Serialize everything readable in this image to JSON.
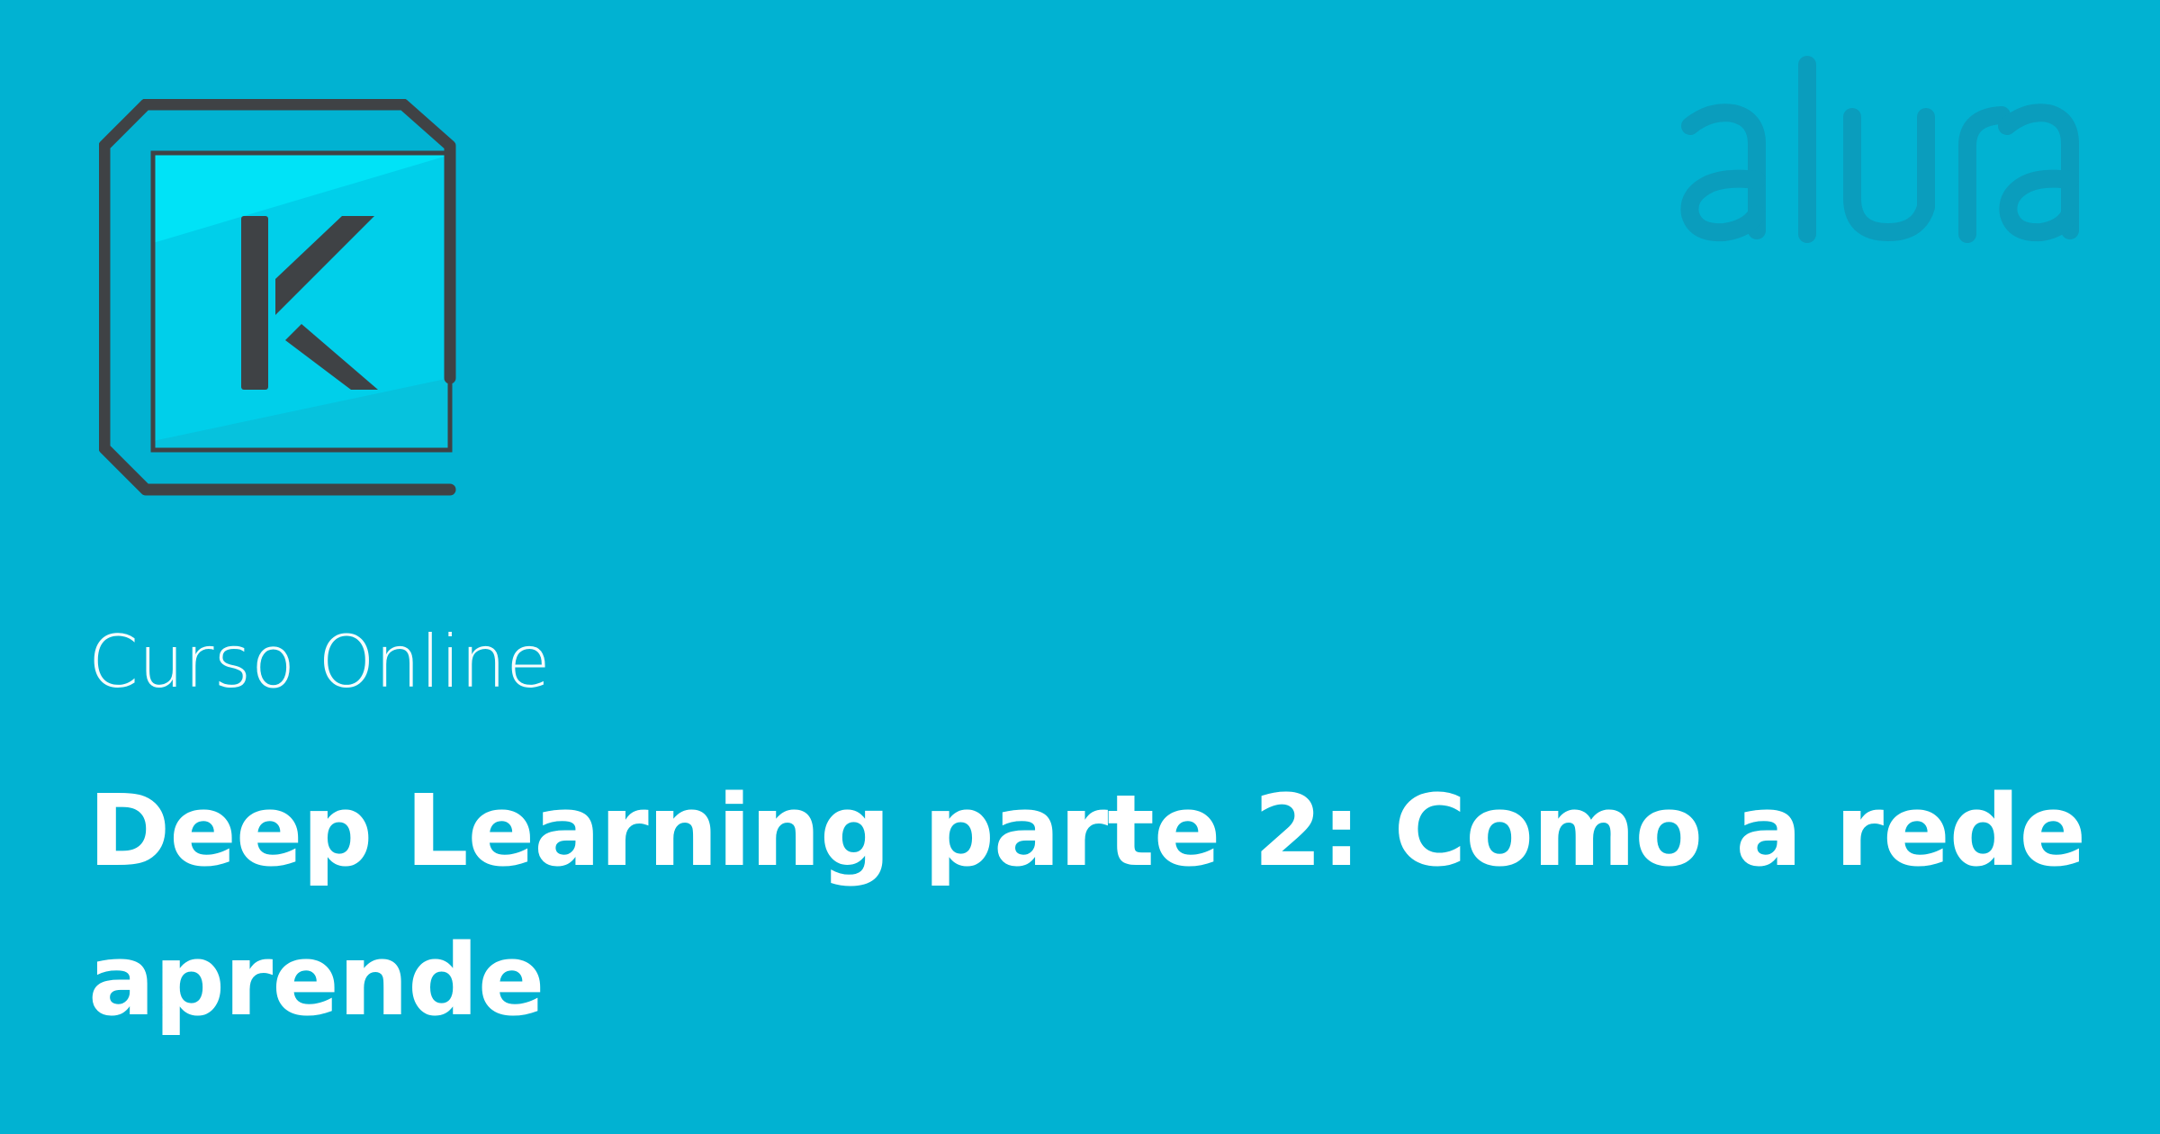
{
  "logo": {
    "icon": "keras-k-icon",
    "letter": "K",
    "frame_color": "#3f4245",
    "tile_color": "#00d4ef"
  },
  "brand": {
    "name": "alura",
    "color": "#0a9dbd"
  },
  "course": {
    "subtitle": "Curso Online",
    "title": "Deep Learning parte 2: Como a rede aprende"
  },
  "colors": {
    "background": "#01b2d2",
    "text": "#ffffff"
  }
}
